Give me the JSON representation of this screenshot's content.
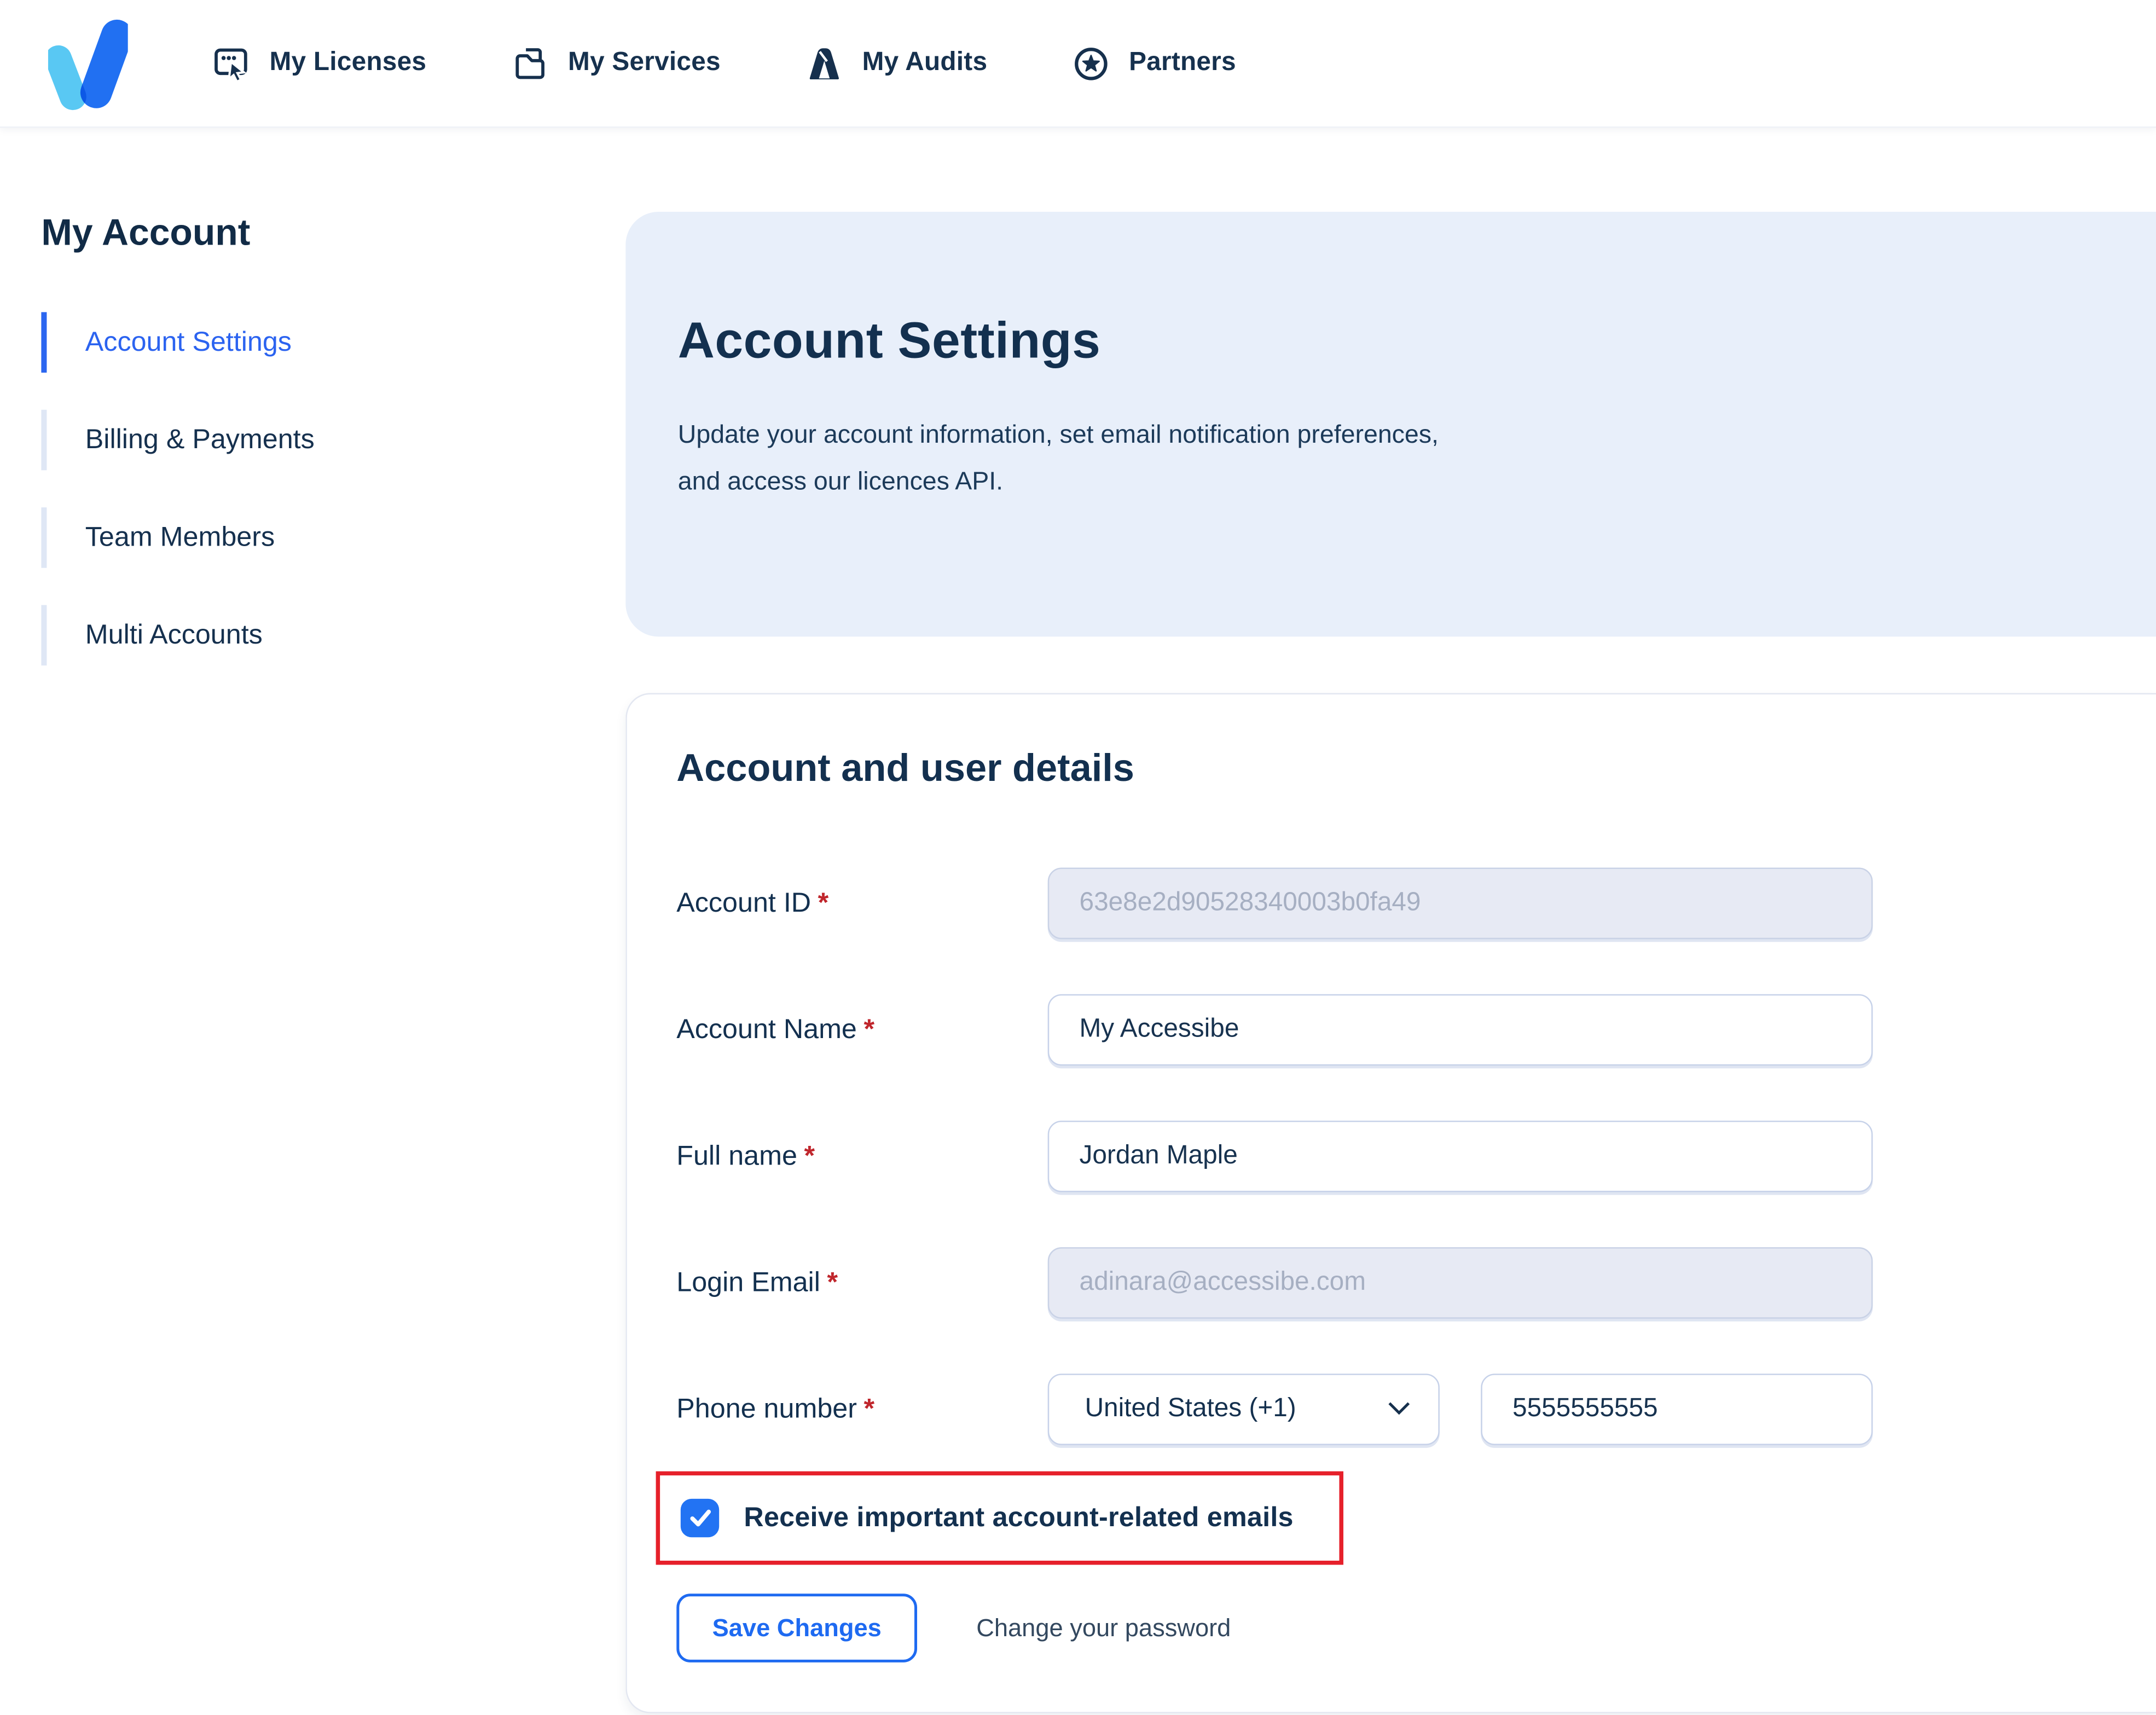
{
  "ui": {
    "required_marker": "*"
  },
  "colors": {
    "brand_navy": "#14304e",
    "accent_blue": "#1e6af1",
    "active_link_blue": "#2b63f0",
    "checkbox_blue": "#2273f3",
    "highlight_red": "#e6202a",
    "header_card_bg": "#e8effa",
    "disabled_input_bg": "#e7eaf4"
  },
  "nav": {
    "items": [
      {
        "label": "My Licenses",
        "icon": "licenses-window-cursor-icon"
      },
      {
        "label": "My Services",
        "icon": "services-folder-icon"
      },
      {
        "label": "My Audits",
        "icon": "audits-easel-icon"
      },
      {
        "label": "Partners",
        "icon": "partners-star-circle-icon"
      }
    ]
  },
  "sidebar": {
    "title": "My Account",
    "items": [
      {
        "label": "Account Settings",
        "active": true
      },
      {
        "label": "Billing & Payments",
        "active": false
      },
      {
        "label": "Team Members",
        "active": false
      },
      {
        "label": "Multi Accounts",
        "active": false
      }
    ]
  },
  "header": {
    "title": "Account Settings",
    "description_line1": "Update your account information, set email notification preferences,",
    "description_line2": "and access our licences API."
  },
  "form": {
    "title": "Account and user details",
    "fields": [
      {
        "label": "Account ID",
        "required": true,
        "value": "63e8e2d90528340003b0fa49",
        "disabled": true
      },
      {
        "label": "Account Name",
        "required": true,
        "value": "My Accessibe",
        "disabled": false
      },
      {
        "label": "Full name",
        "required": true,
        "value": "Jordan Maple",
        "disabled": false
      },
      {
        "label": "Login Email",
        "required": true,
        "value": "adinara@accessibe.com",
        "disabled": true
      },
      {
        "label": "Phone number",
        "required": true,
        "country_code": "United States (+1)",
        "number": "5555555555"
      }
    ],
    "checkbox": {
      "label": "Receive important account-related emails",
      "checked": true,
      "highlighted": true
    },
    "actions": {
      "save_label": "Save Changes",
      "change_password_label": "Change your password"
    }
  }
}
